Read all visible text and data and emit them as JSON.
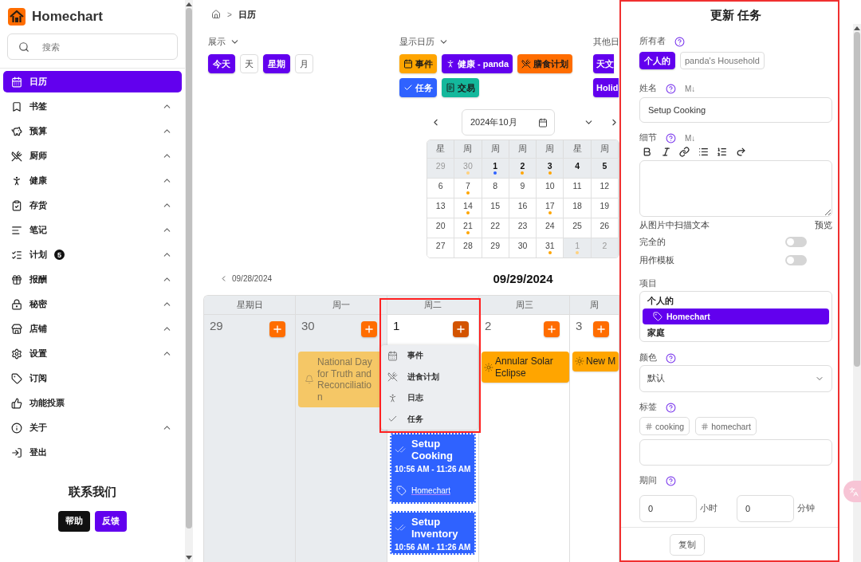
{
  "sidebar": {
    "brand": "Homechart",
    "search": {
      "placeholder": "搜索"
    },
    "items": [
      {
        "label": "日历",
        "selected": true,
        "expandable": false
      },
      {
        "label": "书签",
        "selected": false,
        "expandable": true
      },
      {
        "label": "预算",
        "selected": false,
        "expandable": true
      },
      {
        "label": "厨师",
        "selected": false,
        "expandable": true
      },
      {
        "label": "健康",
        "selected": false,
        "expandable": true
      },
      {
        "label": "存货",
        "selected": false,
        "expandable": true
      },
      {
        "label": "笔记",
        "selected": false,
        "expandable": true
      },
      {
        "label": "计划",
        "selected": false,
        "expandable": true,
        "badge": "5"
      },
      {
        "label": "报酬",
        "selected": false,
        "expandable": true
      },
      {
        "label": "秘密",
        "selected": false,
        "expandable": true
      },
      {
        "label": "店铺",
        "selected": false,
        "expandable": true
      },
      {
        "label": "设置",
        "selected": false,
        "expandable": true
      },
      {
        "label": "订阅",
        "selected": false,
        "expandable": false
      },
      {
        "label": "功能投票",
        "selected": false,
        "expandable": false
      },
      {
        "label": "关于",
        "selected": false,
        "expandable": true
      },
      {
        "label": "登出",
        "selected": false,
        "expandable": false
      }
    ],
    "contact": {
      "title": "联系我们",
      "buttons": [
        {
          "label": "帮助",
          "kind": "dark"
        },
        {
          "label": "反馈",
          "kind": "primary"
        }
      ]
    }
  },
  "breadcrumb": {
    "separator": ">",
    "current": "日历"
  },
  "filters": [
    {
      "title": "展示",
      "dropdown": true,
      "buttons": [
        {
          "label": "今天",
          "kind": "action"
        },
        {
          "label": "天",
          "kind": "view",
          "selected": false
        },
        {
          "label": "星期",
          "kind": "view",
          "selected": true
        },
        {
          "label": "月",
          "kind": "view",
          "selected": false
        }
      ]
    },
    {
      "title": "显示日历",
      "dropdown": true,
      "chips": [
        {
          "label": "事件",
          "color": "#ffa500"
        },
        {
          "label": "健康 - panda",
          "color": "#6200ee"
        },
        {
          "label": "膳食计划",
          "color": "#ff6d00"
        },
        {
          "label": "任务",
          "color": "#2f62ff"
        },
        {
          "label": "交易",
          "color": "#14b89c"
        }
      ]
    },
    {
      "title": "其他日",
      "chips": [
        {
          "label": "天文",
          "color": "#6200ee"
        },
        {
          "label": "Holid",
          "color": "#6200ee"
        }
      ]
    }
  ],
  "mini_calendar": {
    "month": "2024年10月",
    "weekdays": [
      "星",
      "周",
      "周",
      "周",
      "周",
      "星",
      "周"
    ],
    "weeks": [
      {
        "selected": true,
        "days": [
          {
            "day": "29",
            "outside": true
          },
          {
            "day": "30",
            "outside": true,
            "color": "#ffd27f"
          },
          {
            "day": "1",
            "outside": false,
            "color": "#2f62ff"
          },
          {
            "day": "2",
            "outside": false,
            "color": "#ffa500"
          },
          {
            "day": "3",
            "outside": false,
            "color": "#ffa500"
          },
          {
            "day": "4",
            "outside": false
          },
          {
            "day": "5",
            "outside": false
          }
        ]
      },
      {
        "selected": false,
        "days": [
          {
            "day": "6",
            "outside": false
          },
          {
            "day": "7",
            "outside": false,
            "color": "#ffa500"
          },
          {
            "day": "8",
            "outside": false
          },
          {
            "day": "9",
            "outside": false
          },
          {
            "day": "10",
            "outside": false
          },
          {
            "day": "11",
            "outside": false
          },
          {
            "day": "12",
            "outside": false
          }
        ]
      },
      {
        "selected": false,
        "days": [
          {
            "day": "13",
            "outside": false
          },
          {
            "day": "14",
            "outside": false,
            "color": "#ffa500"
          },
          {
            "day": "15",
            "outside": false
          },
          {
            "day": "16",
            "outside": false
          },
          {
            "day": "17",
            "outside": false,
            "color": "#ffa500"
          },
          {
            "day": "18",
            "outside": false
          },
          {
            "day": "19",
            "outside": false
          }
        ]
      },
      {
        "selected": false,
        "days": [
          {
            "day": "20",
            "outside": false
          },
          {
            "day": "21",
            "outside": false,
            "color": "#ffa500"
          },
          {
            "day": "22",
            "outside": false
          },
          {
            "day": "23",
            "outside": false
          },
          {
            "day": "24",
            "outside": false
          },
          {
            "day": "25",
            "outside": false
          },
          {
            "day": "26",
            "outside": false
          }
        ]
      },
      {
        "selected": false,
        "days": [
          {
            "day": "27",
            "outside": false
          },
          {
            "day": "28",
            "outside": false
          },
          {
            "day": "29",
            "outside": false
          },
          {
            "day": "30",
            "outside": false
          },
          {
            "day": "31",
            "outside": false,
            "color": "#ffa500"
          },
          {
            "day": "1",
            "outside": true,
            "color": "#ffd27f"
          },
          {
            "day": "2",
            "outside": true
          }
        ]
      }
    ]
  },
  "week_view": {
    "prev": "09/28/2024",
    "title": "09/29/2024",
    "columns": [
      {
        "weekday": "星期日",
        "day": "29",
        "past": true,
        "today": false,
        "menu_open": false
      },
      {
        "weekday": "周一",
        "day": "30",
        "past": true,
        "today": false,
        "menu_open": false,
        "events": [
          {
            "kind": "holiday",
            "title": "National Day for Truth and Reconciliation"
          }
        ]
      },
      {
        "weekday": "周二",
        "day": "1",
        "past": false,
        "today": true,
        "menu_open": true,
        "menu": {
          "highlighted": true,
          "items": [
            {
              "label": "事件"
            },
            {
              "label": "进食计划"
            },
            {
              "label": "日志"
            },
            {
              "label": "任务"
            }
          ]
        },
        "events": [
          {
            "kind": "task",
            "title": "Setup Cooking",
            "time": "10:56 AM - 11:26 AM",
            "project": "Homechart"
          },
          {
            "kind": "task",
            "title": "Setup Inventory",
            "time": "10:56 AM - 11:26 AM"
          }
        ]
      },
      {
        "weekday": "周三",
        "day": "2",
        "past": false,
        "today": false,
        "menu_open": false,
        "events": [
          {
            "kind": "astronomy",
            "title": "Annular Solar Eclipse"
          }
        ]
      },
      {
        "weekday": "周",
        "day": "3",
        "past": false,
        "today": false,
        "menu_open": false,
        "events": [
          {
            "kind": "astronomy",
            "title": "New M"
          }
        ]
      }
    ]
  },
  "task_form": {
    "title": "更新 任务",
    "highlighted": true,
    "owner": {
      "label": "所有者",
      "help": true,
      "options": [
        {
          "label": "个人的",
          "selected": true
        },
        {
          "label": "panda's Household",
          "selected": false
        }
      ]
    },
    "name": {
      "label": "姓名",
      "help": true,
      "markdown": "M↓",
      "value": "Setup Cooking"
    },
    "details": {
      "label": "细节",
      "help": true,
      "markdown": "M↓"
    },
    "scan_link": "从图片中扫描文本",
    "preview_link": "预览",
    "toggles": [
      {
        "label": "完全的",
        "on": false
      },
      {
        "label": "用作模板",
        "on": false
      }
    ],
    "project": {
      "label": "项目",
      "items": [
        {
          "kind": "group",
          "label": "个人的"
        },
        {
          "kind": "option",
          "label": "Homechart",
          "selected": true
        },
        {
          "kind": "group",
          "label": "家庭"
        }
      ]
    },
    "color": {
      "label": "颜色",
      "help": true,
      "value": "默认"
    },
    "tags": {
      "label": "标签",
      "help": true,
      "items": [
        {
          "label": "cooking"
        },
        {
          "label": "homechart"
        }
      ]
    },
    "duration": {
      "label": "期间",
      "help": true,
      "fields": [
        {
          "value": "0",
          "unit": "小时"
        },
        {
          "value": "0",
          "unit": "分钟"
        }
      ]
    },
    "buttons": [
      {
        "label": "复制"
      }
    ]
  }
}
